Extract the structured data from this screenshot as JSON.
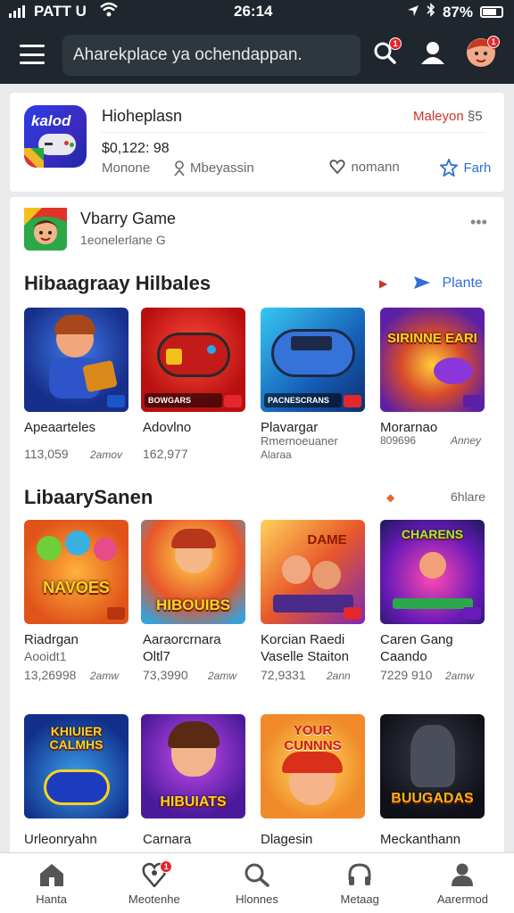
{
  "status_bar": {
    "carrier": "PATT U",
    "time": "26:14",
    "battery": "87%"
  },
  "header": {
    "search_text": "Aharekplace ya ochendappan."
  },
  "featured_app": {
    "name": "Hioheplasn",
    "brand": "Maleyon",
    "brand_suffix": "§5",
    "price": "$0,122: 98",
    "meta_left": "Monone",
    "meta_person": "Mbeyassin",
    "fav_label": "nomann",
    "fav2_label": "Farh",
    "icon_text": "kalod"
  },
  "game_header": {
    "title": "Vbarry Game",
    "subtitle": "1eonelerlane G"
  },
  "sections": [
    {
      "title": "Hibaagraay Hilbales",
      "action": "Plante"
    },
    {
      "title": "LibaarySanen",
      "action": "6hlare"
    }
  ],
  "row1": [
    {
      "tag": "",
      "title": "Apeaarteles",
      "title2": "",
      "count": "113,059",
      "age": "2amov"
    },
    {
      "tag": "BOWGARS",
      "title": "Adovlno",
      "title2": "",
      "count": "162,977",
      "age": ""
    },
    {
      "tag": "PACNESCRANS",
      "title": "Plavargar",
      "title2": "Rmernoeuaner",
      "count": "Alaraa",
      "age": ""
    },
    {
      "tag": "",
      "title": "Morarnao",
      "title2": "",
      "count": "809696",
      "age": "Anney"
    }
  ],
  "row1_banners": [
    "",
    "",
    "",
    "SIRINNE EARIEX"
  ],
  "row2": [
    {
      "banner": "NAVOES",
      "title": "Riadrgan",
      "title2": "Aooidt1",
      "count": "13,26998",
      "age": "2amw"
    },
    {
      "banner": "HIBOUIBS",
      "title": "Aaraorcrnara",
      "title2": "Oltl7",
      "count": "73,3990",
      "age": "2amw"
    },
    {
      "banner": "DAME",
      "title": "Korcian Raedi",
      "title2": "Vaselle Staiton",
      "count": "72,9331",
      "age": "2ann"
    },
    {
      "banner": "CHARENS",
      "title": "Caren Gang",
      "title2": "Caando",
      "count": "7229 910",
      "age": "2amw"
    }
  ],
  "row3": [
    {
      "banner": "KHIUIER CALMHS",
      "title": "Urleonryahn"
    },
    {
      "banner": "HIBUIATS",
      "title": "Carnara"
    },
    {
      "banner": "YOUR CUNNNS",
      "title": "Dlagesin"
    },
    {
      "banner": "BUUGADAS",
      "title": "Meckanthann"
    }
  ],
  "bottom_nav": [
    {
      "label": "Hanta"
    },
    {
      "label": "Meotenhe",
      "badge": "1"
    },
    {
      "label": "Hlonnes"
    },
    {
      "label": "Metaag"
    },
    {
      "label": "Aarermod"
    }
  ],
  "badges": {
    "search": "1",
    "avatar": "1"
  }
}
